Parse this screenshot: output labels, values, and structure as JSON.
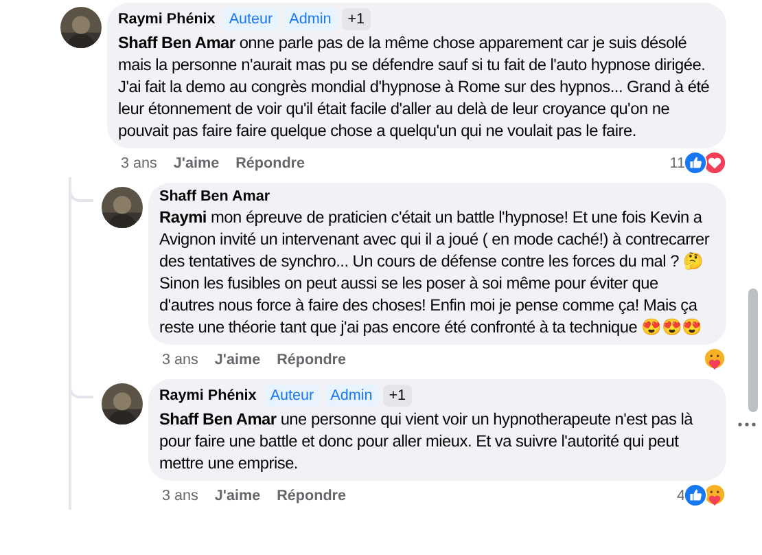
{
  "comments": [
    {
      "author": "Raymi Phénix",
      "badges": [
        {
          "label": "Auteur",
          "kind": "role"
        },
        {
          "label": "Admin",
          "kind": "role"
        },
        {
          "label": "+1",
          "kind": "count"
        }
      ],
      "paragraphs": [
        "**Shaff Ben Amar** onne parle pas de la même chose apparement car je suis désolé mais la personne n'aurait mas pu se défendre sauf si tu fait de l'auto hypnose dirigée.",
        "J'ai fait la demo au congrès mondial d'hypnose à Rome sur des hypnos... Grand à été leur étonnement de voir qu'il était facile d'aller au delà de leur croyance qu'on ne pouvait pas faire faire quelque chose a quelqu'un qui ne voulait pas le faire."
      ],
      "time": "3 ans",
      "like": "J'aime",
      "reply": "Répondre",
      "reaction_count": "11",
      "reactions": [
        {
          "kind": "like"
        },
        {
          "kind": "love"
        }
      ],
      "menu_visible": false,
      "children": [
        {
          "author": "Shaff Ben Amar",
          "paragraphs": [
            "**Raymi** mon épreuve de praticien c'était un battle l'hypnose! Et une fois Kevin a Avignon invité un intervenant avec qui il a joué ( en mode caché!) à contrecarrer des tentatives de synchro... Un cours de défense contre les forces du mal ? 🤔 Sinon les fusibles on peut aussi se les poser à soi même pour éviter que d'autres nous force à faire des choses! Enfin moi je pense comme ça! Mais ça reste une théorie tant que j'ai pas encore été confronté à ta technique 😍😍😍"
          ],
          "time": "3 ans",
          "like": "J'aime",
          "reply": "Répondre",
          "reactions": [
            {
              "kind": "care"
            }
          ],
          "menu_visible": false
        },
        {
          "author": "Raymi Phénix",
          "badges": [
            {
              "label": "Auteur",
              "kind": "role"
            },
            {
              "label": "Admin",
              "kind": "role"
            },
            {
              "label": "+1",
              "kind": "count"
            }
          ],
          "paragraphs": [
            "**Shaff Ben Amar** une personne qui vient voir un hypnotherapeute n'est pas là pour faire une battle et donc pour aller mieux. Et va suivre l'autorité qui peut mettre une emprise."
          ],
          "time": "3 ans",
          "like": "J'aime",
          "reply": "Répondre",
          "reaction_count": "4",
          "reactions": [
            {
              "kind": "like"
            },
            {
              "kind": "care"
            }
          ],
          "menu_visible": true
        }
      ]
    }
  ]
}
